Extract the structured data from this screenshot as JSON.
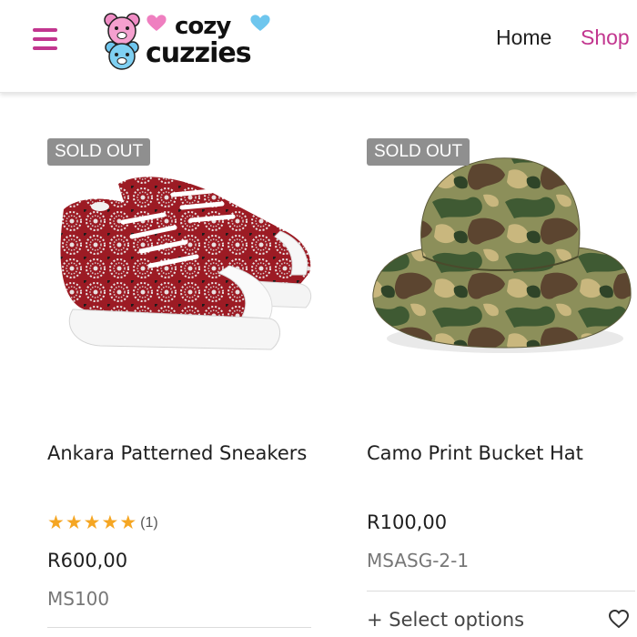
{
  "colors": {
    "accent": "#c2368f",
    "star": "#f5a623",
    "badge_bg": "#8f8f8f"
  },
  "header": {
    "menu_icon": "hamburger-menu-icon",
    "logo": {
      "line1": "cozy",
      "line2": "cuzzies"
    },
    "nav": {
      "home": "Home",
      "shop": "Shop"
    }
  },
  "products": [
    {
      "badge": "SOLD OUT",
      "title": "Ankara Patterned Sneakers",
      "rating": {
        "stars": 5,
        "max": 5,
        "count": "(1)"
      },
      "price": "R600,00",
      "sku": "MS100",
      "image": "ankara-sneakers-image"
    },
    {
      "badge": "SOLD OUT",
      "title": "Camo Print Bucket Hat",
      "price": "R100,00",
      "sku": "MSASG-2-1",
      "action": "+ Select options",
      "wishlist_icon": "heart-icon",
      "image": "camo-bucket-hat-image"
    }
  ]
}
